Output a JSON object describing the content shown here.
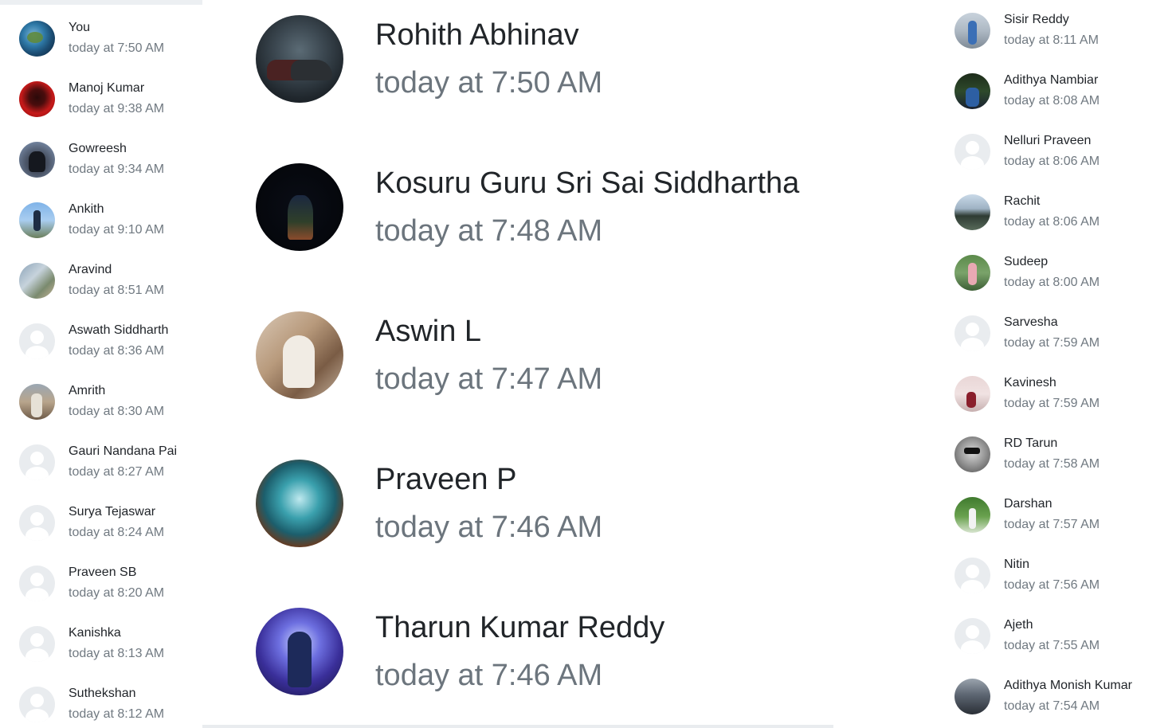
{
  "left_list": [
    {
      "name": "You",
      "time": "today at 7:50 AM"
    },
    {
      "name": "Manoj Kumar",
      "time": "today at 9:38 AM"
    },
    {
      "name": "Gowreesh",
      "time": "today at 9:34 AM"
    },
    {
      "name": "Ankith",
      "time": "today at 9:10 AM"
    },
    {
      "name": "Aravind",
      "time": "today at 8:51 AM"
    },
    {
      "name": "Aswath Siddharth",
      "time": "today at 8:36 AM"
    },
    {
      "name": "Amrith",
      "time": "today at 8:30 AM"
    },
    {
      "name": "Gauri Nandana Pai",
      "time": "today at 8:27 AM"
    },
    {
      "name": "Surya Tejaswar",
      "time": "today at 8:24 AM"
    },
    {
      "name": "Praveen SB",
      "time": "today at 8:20 AM"
    },
    {
      "name": "Kanishka",
      "time": "today at 8:13 AM"
    },
    {
      "name": "Suthekshan",
      "time": "today at 8:12 AM"
    }
  ],
  "featured_list": [
    {
      "name": "Rohith Abhinav",
      "time": "today at 7:50 AM"
    },
    {
      "name": "Kosuru Guru Sri Sai Siddhartha",
      "time": "today at 7:48 AM"
    },
    {
      "name": "Aswin L",
      "time": "today at 7:47 AM"
    },
    {
      "name": "Praveen P",
      "time": "today at 7:46 AM"
    },
    {
      "name": "Tharun Kumar Reddy",
      "time": "today at 7:46 AM"
    }
  ],
  "right_list": [
    {
      "name": "Sisir Reddy",
      "time": "today at 8:11 AM"
    },
    {
      "name": "Adithya Nambiar",
      "time": "today at 8:08 AM"
    },
    {
      "name": "Nelluri Praveen",
      "time": "today at 8:06 AM"
    },
    {
      "name": "Rachit",
      "time": "today at 8:06 AM"
    },
    {
      "name": "Sudeep",
      "time": "today at 8:00 AM"
    },
    {
      "name": "Sarvesha",
      "time": "today at 7:59 AM"
    },
    {
      "name": "Kavinesh",
      "time": "today at 7:59 AM"
    },
    {
      "name": "RD Tarun",
      "time": "today at 7:58 AM"
    },
    {
      "name": "Darshan",
      "time": "today at 7:57 AM"
    },
    {
      "name": "Nitin",
      "time": "today at 7:56 AM"
    },
    {
      "name": "Ajeth",
      "time": "today at 7:55 AM"
    },
    {
      "name": "Adithya Monish Kumar",
      "time": "today at 7:54 AM"
    }
  ]
}
